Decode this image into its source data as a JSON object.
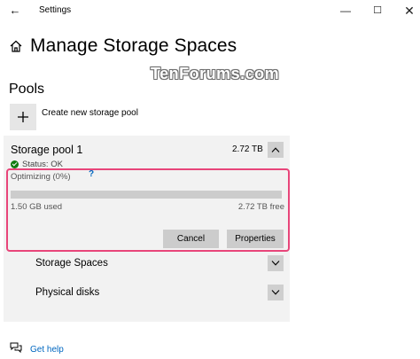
{
  "window": {
    "title": "Settings",
    "back_glyph": "←",
    "minimize_glyph": "—",
    "maximize_glyph": "☐",
    "close_glyph": "✕"
  },
  "page": {
    "title": "Manage Storage Spaces",
    "icon": "home-icon"
  },
  "watermark": "TenForums.com",
  "pools": {
    "section_title": "Pools",
    "create_label": "Create new storage pool",
    "create_icon": "plus-icon"
  },
  "pool": {
    "name": "Storage pool 1",
    "size": "2.72 TB",
    "status": "Status: OK",
    "optimizing": "Optimizing (0%)",
    "help_glyph": "?",
    "progress": 0,
    "used": "1.50 GB used",
    "free": "2.72 TB free",
    "cancel_label": "Cancel",
    "properties_label": "Properties",
    "storage_spaces_label": "Storage Spaces",
    "physical_disks_label": "Physical disks"
  },
  "footer": {
    "get_help_label": "Get help"
  },
  "colors": {
    "accent": "#0067c0",
    "status_ok": "#107c10",
    "highlight": "#e8457a"
  }
}
